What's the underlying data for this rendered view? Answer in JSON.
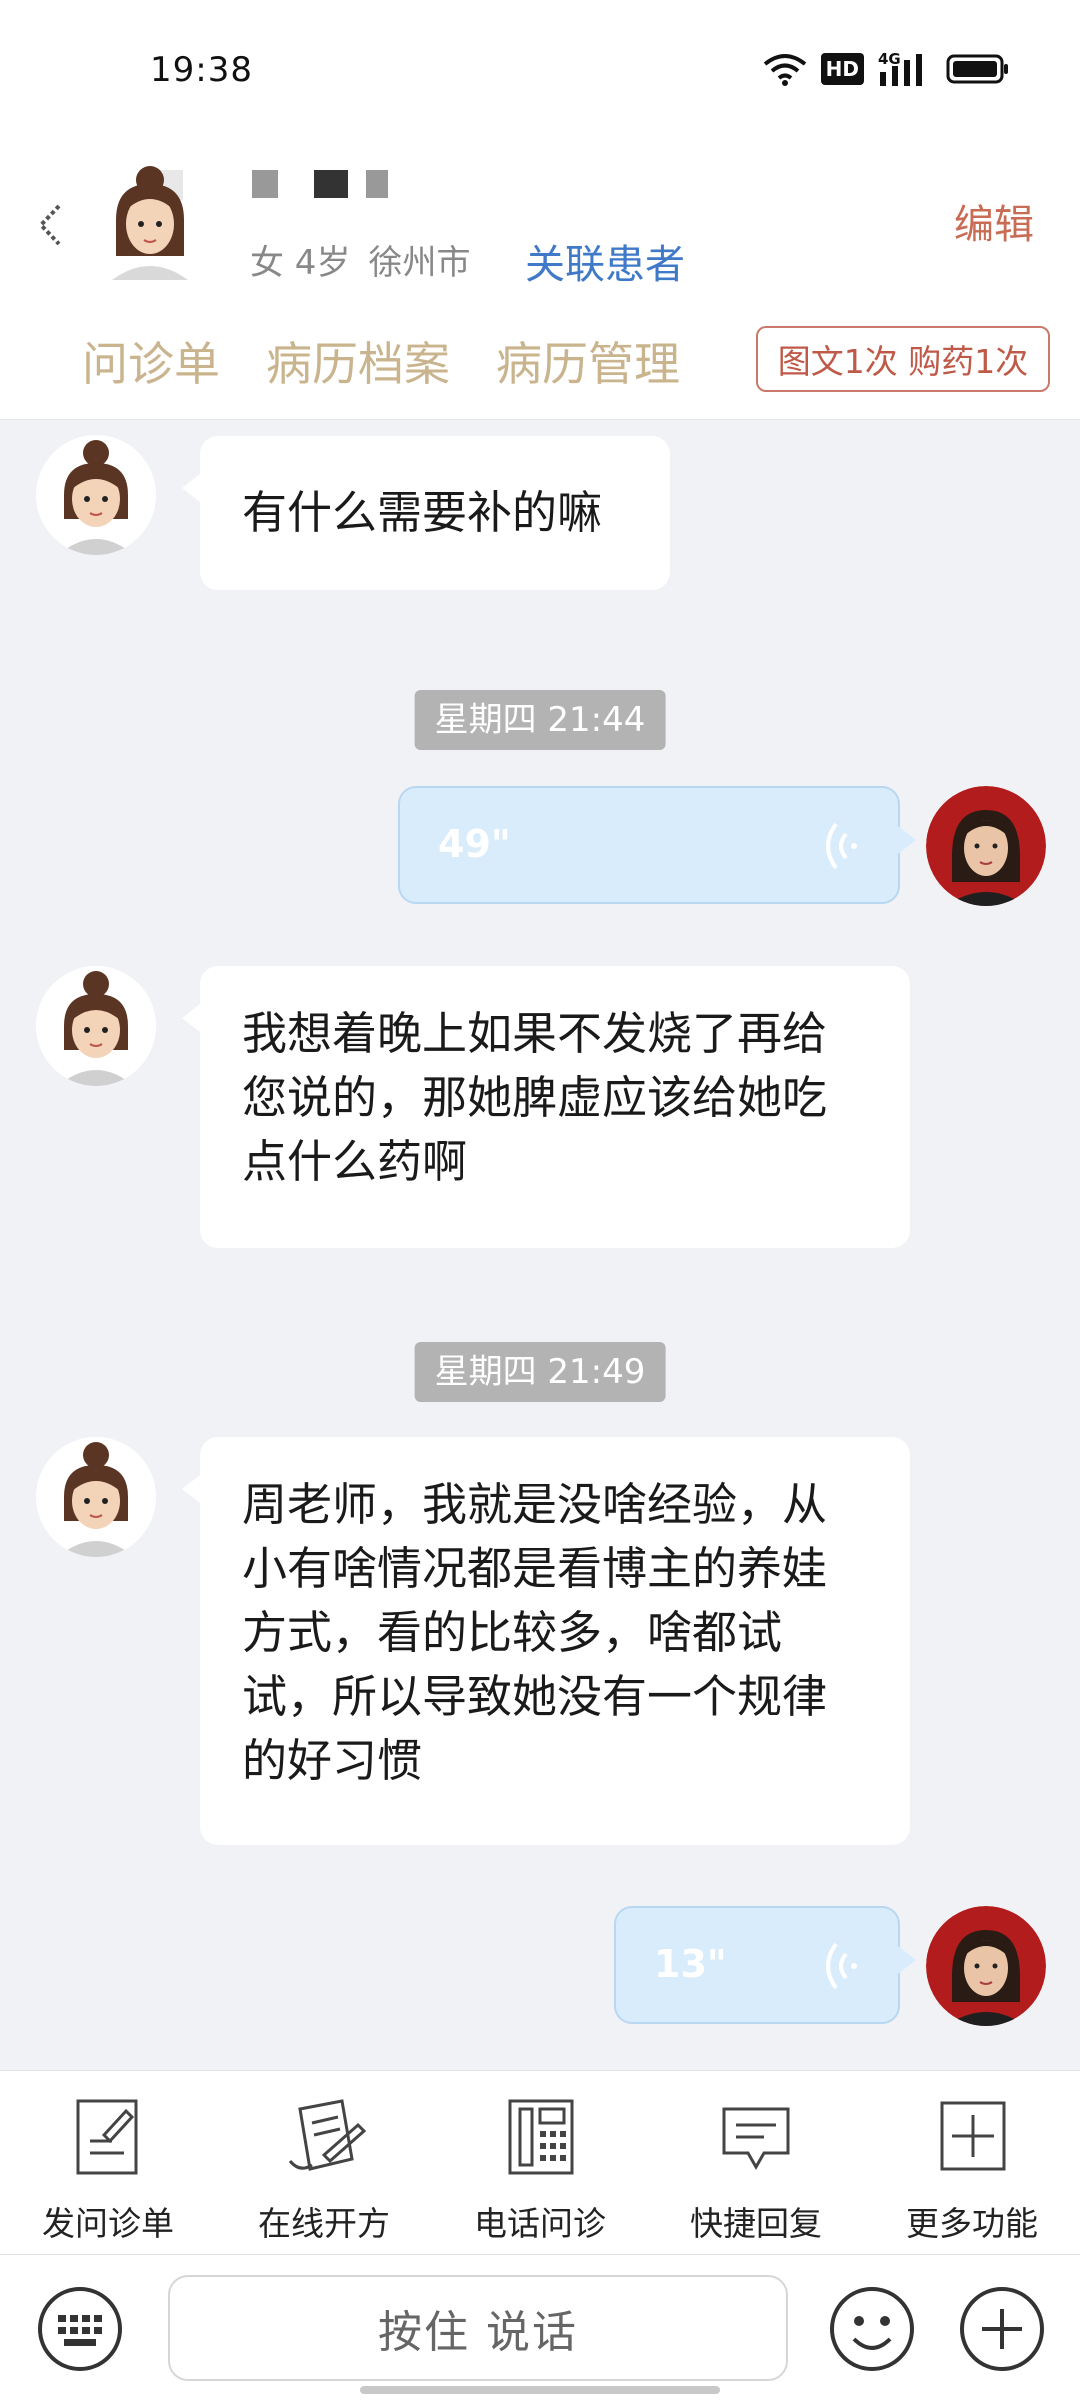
{
  "status_bar": {
    "time": "19:38",
    "hd": "HD",
    "network": "4G"
  },
  "header": {
    "meta": {
      "gender_age": "女 4岁",
      "city": "徐州市"
    },
    "link_patient": "关联患者",
    "edit": "编辑",
    "tabs": [
      "问诊单",
      "病历档案",
      "病历管理"
    ],
    "quota": "图文1次 购药1次"
  },
  "chat": {
    "messages": [
      {
        "text": "有什么需要补的嘛"
      },
      {
        "time": "星期四 21:44"
      },
      {
        "voice": "49\""
      },
      {
        "lines": [
          "我想着晚上如果不发烧了再给",
          "您说的，那她脾虚应该给她吃",
          "点什么药啊"
        ]
      },
      {
        "time": "星期四 21:49"
      },
      {
        "lines": [
          "周老师，我就是没啥经验，从",
          "小有啥情况都是看博主的养娃",
          "方式，看的比较多，啥都试",
          "试，所以导致她没有一个规律",
          "的好习惯"
        ]
      },
      {
        "voice": "13\""
      }
    ]
  },
  "toolbar": {
    "items": [
      {
        "label": "发问诊单",
        "icon": "form-icon"
      },
      {
        "label": "在线开方",
        "icon": "prescription-icon"
      },
      {
        "label": "电话问诊",
        "icon": "phone-icon"
      },
      {
        "label": "快捷回复",
        "icon": "chat-bubble-icon"
      },
      {
        "label": "更多功能",
        "icon": "plus-box-icon"
      }
    ]
  },
  "input": {
    "hold_to_talk": "按住 说话"
  },
  "colors": {
    "accent_blue": "#3f79c7",
    "tab_gold": "#c9b48e",
    "edit_red": "#c86c55",
    "voice_bubble": "#d9ecfb"
  }
}
